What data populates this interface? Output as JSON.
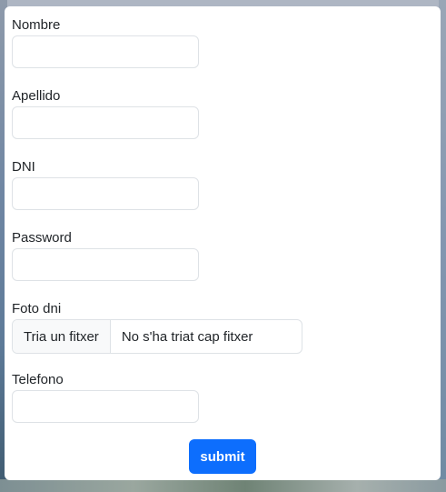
{
  "form": {
    "nombre": {
      "label": "Nombre",
      "value": ""
    },
    "apellido": {
      "label": "Apellido",
      "value": ""
    },
    "dni": {
      "label": "DNI",
      "value": ""
    },
    "password": {
      "label": "Password",
      "value": ""
    },
    "foto_dni": {
      "label": "Foto dni",
      "button_label": "Tria un fitxer",
      "file_status": "No s'ha triat cap fitxer"
    },
    "telefono": {
      "label": "Telefono",
      "value": ""
    },
    "submit_label": "submit"
  },
  "colors": {
    "primary": "#0d6efd",
    "border": "#dee2e6",
    "text": "#212529"
  }
}
